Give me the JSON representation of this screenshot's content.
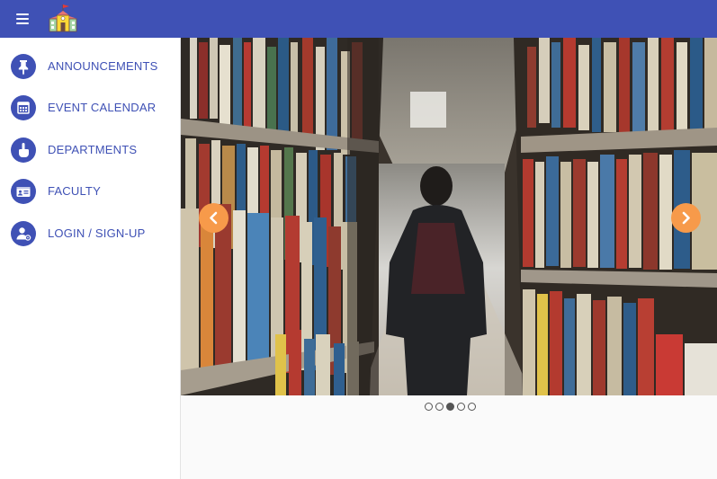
{
  "header": {
    "menu_icon": "hamburger-menu-icon",
    "logo_icon": "school-building-icon",
    "bar_color": "#3f51b5"
  },
  "sidebar": {
    "items": [
      {
        "label": "ANNOUNCEMENTS",
        "icon": "pin-icon"
      },
      {
        "label": "EVENT CALENDAR",
        "icon": "calendar-icon"
      },
      {
        "label": "DEPARTMENTS",
        "icon": "hand-point-up-icon"
      },
      {
        "label": "FACULTY",
        "icon": "id-card-icon"
      },
      {
        "label": "LOGIN / SIGN-UP",
        "icon": "user-gear-icon"
      }
    ],
    "accent_color": "#3f51b5"
  },
  "carousel": {
    "image": "library-bookshelf-aisle-photo",
    "prev_icon": "chevron-left-icon",
    "next_icon": "chevron-right-icon",
    "arrow_color": "#f79a4a",
    "slide_count": 5,
    "active_slide": 3
  }
}
